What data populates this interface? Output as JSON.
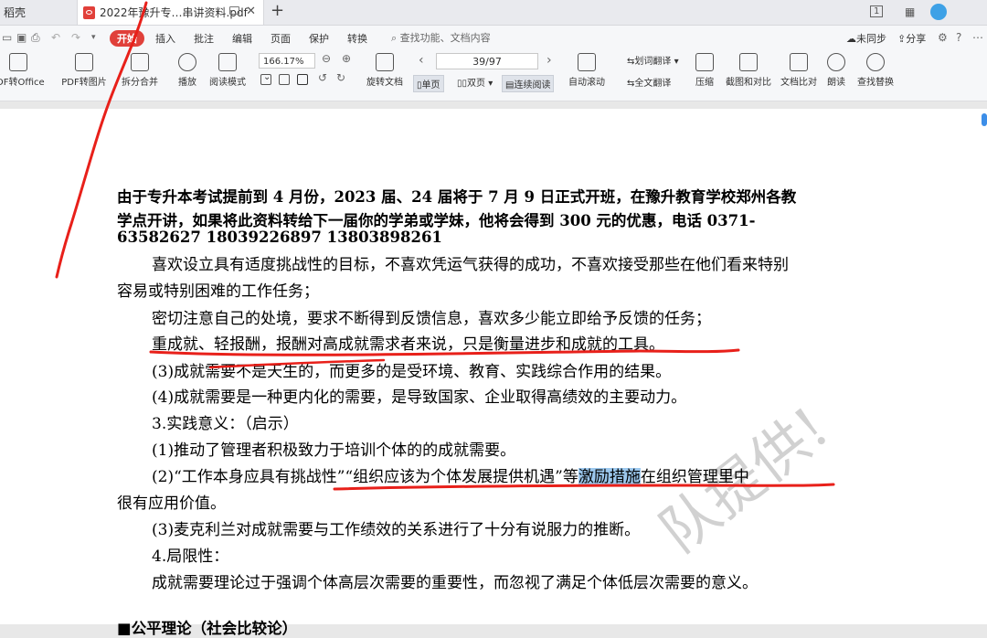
{
  "tabs": {
    "home": "稻壳",
    "active": "2022年豫升专…串讲资料.pdf"
  },
  "menu": {
    "start": "开始",
    "items": [
      "插入",
      "批注",
      "编辑",
      "页面",
      "保护",
      "转换"
    ],
    "search": "查找功能、文档内容",
    "sync": "未同步",
    "share": "分享"
  },
  "toolbar": {
    "pdf_to_office": "DF转Office",
    "pdf_to_image": "PDF转图片",
    "split_merge": "拆分合并",
    "play": "播放",
    "reading_mode": "阅读模式",
    "zoom": "166.17%",
    "rotate": "旋转文档",
    "page": "39/97",
    "single": "单页",
    "double": "双页",
    "continuous": "连续阅读",
    "auto_scroll": "自动滚动",
    "word_translate": "划词翻译",
    "full_translate": "全文翻译",
    "compress": "压缩",
    "screenshot_compare": "截图和对比",
    "doc_compare": "文档比对",
    "read_aloud": "朗读",
    "find_replace": "查找替换"
  },
  "document": {
    "notice_1": "由于专升本考试提前到 4 月份，2023 届、24 届将于 7 月 9 日正式开班，在豫升教育学校郑州各教",
    "notice_2": "学点开讲，如果将此资料转给下一届你的学弟或学妹，他将会得到  300  元的优惠，电话  0371-",
    "notice_3": "63582627    18039226897    13803898261",
    "p1_a": "喜欢设立具有适度挑战性的目标，不喜欢凭运气获得的成功，不喜欢接受那些在他们看来特别",
    "p1_b": "容易或特别困难的工作任务；",
    "p2": "密切注意自己的处境，要求不断得到反馈信息，喜欢多少能立即给予反馈的任务；",
    "p3": "重成就、轻报酬，报酬对高成就需求者来说，只是衡量进步和成就的工具。",
    "p4": "(3)成就需要不是天生的，而更多的是受环境、教育、实践综合作用的结果。",
    "p5": "(4)成就需要是一种更内化的需要，是导致国家、企业取得高绩效的主要动力。",
    "p6": "3.实践意义：（启示）",
    "p7": "(1)推动了管理者积极致力于培训个体的的成就需要。",
    "p8_a": "(2)“工作本身应具有挑战性”“组织应该为个体发展提供机遇”等",
    "p8_hl": "激励措施",
    "p8_b": "在组织管理里中",
    "p8_c": "很有应用价值。",
    "p9": "(3)麦克利兰对成就需要与工作绩效的关系进行了十分有说服力的推断。",
    "p10": "4.局限性：",
    "p11": "成就需要理论过于强调个体高层次需要的重要性，而忽视了满足个体低层次需要的意义。",
    "p12": "■公平理论（社会比较论）",
    "watermark": "队提供!"
  },
  "colors": {
    "accent": "#e0403a",
    "ink": "#e8201a",
    "highlight": "#9cc8ee"
  }
}
